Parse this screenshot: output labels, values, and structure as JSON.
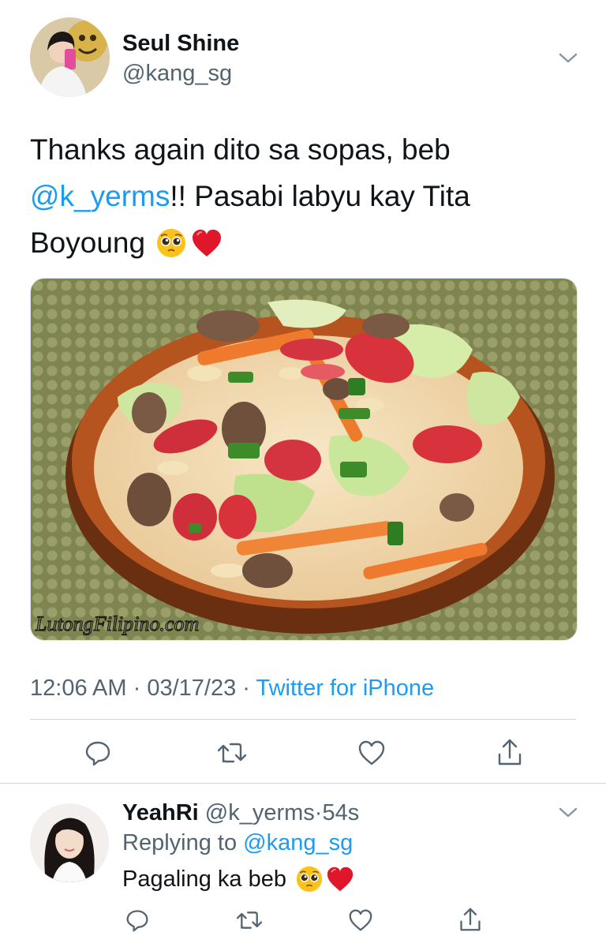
{
  "tweet": {
    "author": {
      "display_name": "Seul Shine",
      "handle": "@kang_sg"
    },
    "text_line1": "Thanks again dito sa sopas, beb",
    "text_mention": "@k_yerms",
    "text_after_mention": "!! Pasabi labyu kay Tita",
    "text_line3": "Boyoung",
    "emojis": [
      "pleading-face",
      "red-heart"
    ],
    "image": {
      "watermark": "LutongFilipino.com",
      "description_icon": "soup-bowl-photo"
    },
    "meta": {
      "time": "12:06 AM",
      "separator": "·",
      "date": "03/17/23",
      "source": "Twitter for iPhone"
    },
    "actions": [
      "reply-icon",
      "retweet-icon",
      "like-icon",
      "share-icon"
    ]
  },
  "reply": {
    "author": {
      "display_name": "YeahRi",
      "handle": "@k_yerms",
      "separator": "·",
      "time": "54s"
    },
    "replying_label": "Replying to",
    "replying_handle": "@kang_sg",
    "text": "Pagaling ka beb",
    "emojis": [
      "pleading-face",
      "red-heart"
    ],
    "actions": [
      "reply-icon",
      "retweet-icon",
      "like-icon",
      "share-icon"
    ]
  },
  "colors": {
    "accent": "#1d9bf0",
    "muted": "#536471",
    "heart": "#e0162b",
    "divider": "#cfd9de"
  }
}
